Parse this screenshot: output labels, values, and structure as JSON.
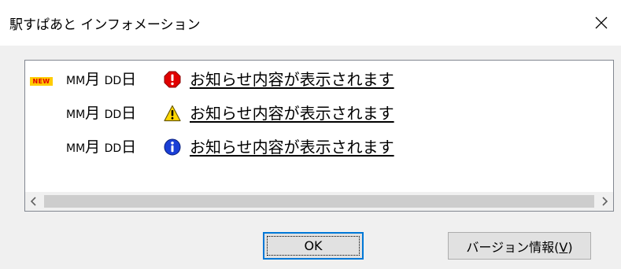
{
  "window": {
    "title": "駅すぱあと インフォメーション",
    "close_glyph": "✕"
  },
  "notices": [
    {
      "is_new": true,
      "new_label": "NEW",
      "date_mm": "MM",
      "date_mm_suffix": "月",
      "date_dd": "DD",
      "date_dd_suffix": "日",
      "icon": "error-icon",
      "icon_color": "#e00000",
      "text": "お知らせ内容が表示されます"
    },
    {
      "is_new": false,
      "date_mm": "MM",
      "date_mm_suffix": "月",
      "date_dd": "DD",
      "date_dd_suffix": "日",
      "icon": "warning-icon",
      "icon_color": "#ffd800",
      "text": "お知らせ内容が表示されます"
    },
    {
      "is_new": false,
      "date_mm": "MM",
      "date_mm_suffix": "月",
      "date_dd": "DD",
      "date_dd_suffix": "日",
      "icon": "info-icon",
      "icon_color": "#1a3fd6",
      "text": "お知らせ内容が表示されます"
    }
  ],
  "buttons": {
    "ok_label": "OK",
    "version_label_prefix": "バージョン情報(",
    "version_accel": "V",
    "version_label_suffix": ")"
  }
}
